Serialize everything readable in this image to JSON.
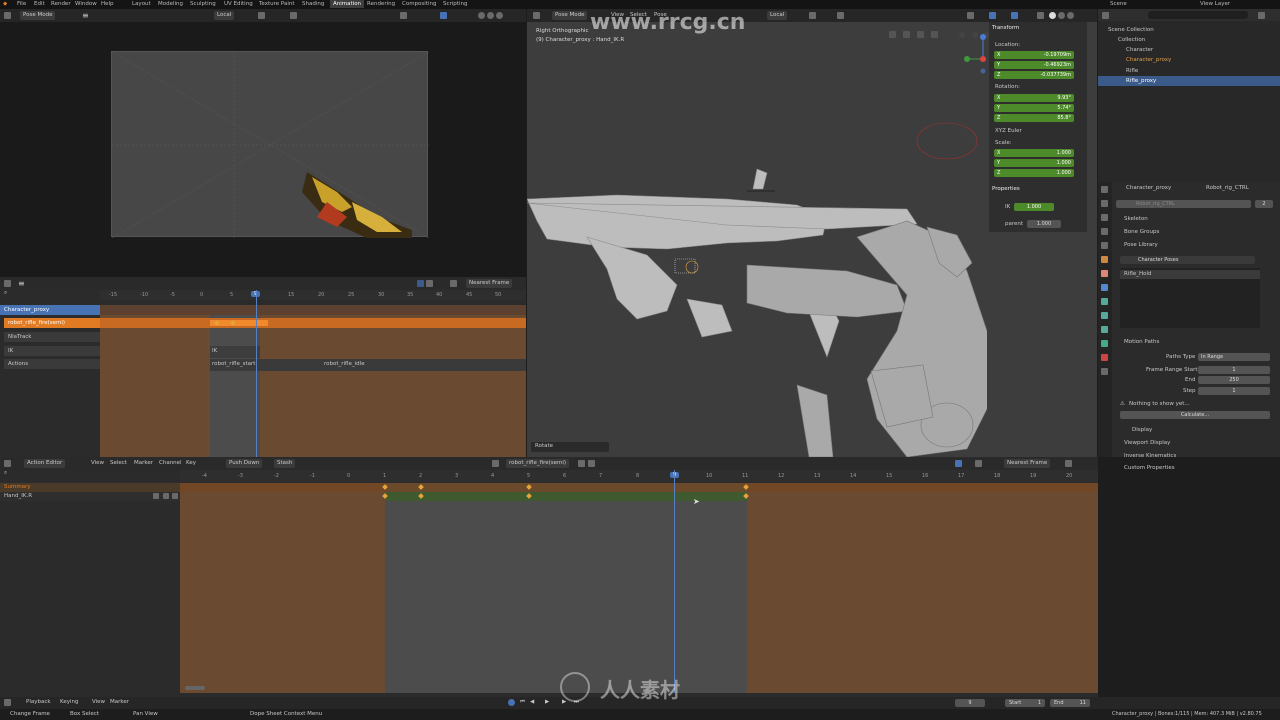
{
  "top_menu": [
    "File",
    "Edit",
    "Render",
    "Window",
    "Help"
  ],
  "workspaces": [
    "Layout",
    "Modeling",
    "Sculpting",
    "UV Editing",
    "Texture Paint",
    "Shading",
    "Animation",
    "Rendering",
    "Compositing",
    "Scripting"
  ],
  "active_workspace": "Animation",
  "scene": "Scene",
  "view_layer": "View Layer",
  "camera_view": {
    "mode": "Pose Mode",
    "orientation": "Local"
  },
  "viewport": {
    "mode": "Pose Mode",
    "menus": [
      "View",
      "Select",
      "Pose"
    ],
    "orientation": "Local",
    "title": "Right Orthographic",
    "subtitle": "(9) Character_proxy : Hand_IK.R",
    "last_op": "Rotate"
  },
  "transform": {
    "title": "Transform",
    "location_label": "Location:",
    "location": [
      "-0.19709m",
      "-0.46923m",
      "-0.037739m"
    ],
    "rotation_label": "Rotation:",
    "rotation": [
      "9.93°",
      "5.74°",
      "85.8°"
    ],
    "rotation_mode": "XYZ Euler",
    "scale_label": "Scale:",
    "scale": [
      "1.000",
      "1.000",
      "1.000"
    ],
    "axis_labels": [
      "X",
      "Y",
      "Z"
    ]
  },
  "properties_panel": {
    "title": "Properties",
    "ik_label": "IK",
    "ik_value": "1.000",
    "parent_label": "parent",
    "parent_value": "1.000"
  },
  "outliner": {
    "root": "Scene Collection",
    "items": [
      "Collection",
      "Character",
      "Character_proxy",
      "Rifle",
      "Rifle_proxy"
    ]
  },
  "armature_props": {
    "breadcrumb": [
      "Character_proxy",
      "Robot_rig_CTRL"
    ],
    "name": "Robot_rig_CTRL",
    "users": "2",
    "sections": [
      "Skeleton",
      "Bone Groups",
      "Pose Library"
    ],
    "pose_library": "Character Poses",
    "pose_item": "Rifle_Hold",
    "motion_paths_title": "Motion Paths",
    "paths_type_label": "Paths Type",
    "paths_type": "In Range",
    "frame_start_label": "Frame Range Start",
    "frame_start": "1",
    "frame_end_label": "End",
    "frame_end": "250",
    "step_label": "Step",
    "step": "1",
    "nothing_msg": "Nothing to show yet...",
    "calculate": "Calculate...",
    "display": "Display",
    "more_sections": [
      "Viewport Display",
      "Inverse Kinematics",
      "Custom Properties"
    ]
  },
  "nla": {
    "snap": "Nearest Frame",
    "ticks": [
      "-15",
      "-10",
      "-5",
      "0",
      "5",
      "9",
      "15",
      "20",
      "25",
      "30",
      "35",
      "40",
      "45",
      "50"
    ],
    "tracks": [
      "Character_proxy",
      "robot_rifle_fire(semi)",
      "NlaTrack",
      "IK",
      "Actions"
    ],
    "strips": [
      "IK",
      "robot_rifle_start",
      "robot_rifle_idle"
    ]
  },
  "dopesheet": {
    "mode": "Action Editor",
    "menus": [
      "View",
      "Select",
      "Marker",
      "Channel",
      "Key"
    ],
    "push_down": "Push Down",
    "stash": "Stash",
    "action": "robot_rifle_fire(semi)",
    "snap": "Nearest Frame",
    "ticks": [
      "-4",
      "-3",
      "-2",
      "-1",
      "0",
      "1",
      "2",
      "3",
      "4",
      "5",
      "6",
      "7",
      "8",
      "9",
      "10",
      "11",
      "12",
      "13",
      "14",
      "15",
      "16",
      "17",
      "18",
      "19",
      "20"
    ],
    "current_frame": "9",
    "channels": [
      "Summary",
      "Hand_IK.R"
    ]
  },
  "timeline": {
    "menus": [
      "Playback",
      "Keying",
      "View",
      "Marker"
    ],
    "frame": "9",
    "start_label": "Start",
    "start": "1",
    "end_label": "End",
    "end": "11"
  },
  "statusbar": {
    "items": [
      "Change Frame",
      "Box Select",
      "Pan View",
      "Dope Sheet Context Menu"
    ],
    "info": "Character_proxy | Bones:1/115 | Mem: 407.3 MiB | v2.80.75"
  },
  "watermarks": [
    "www.rrcg.cn",
    "人人素材"
  ],
  "colors": {
    "accent": "#e07b24",
    "selected_blue": "#4772b3",
    "green_field": "#4d8a2a",
    "playhead": "#5680c2"
  }
}
